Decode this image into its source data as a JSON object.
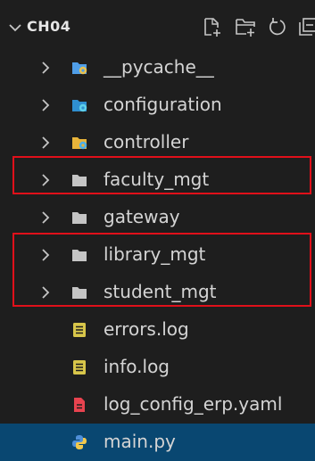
{
  "explorer": {
    "folder_name": "CH04",
    "toolbar": [
      "new-file-icon",
      "new-folder-icon",
      "refresh-icon",
      "collapse-all-icon"
    ],
    "items": [
      {
        "label": "__pycache__",
        "kind": "folder",
        "icon": "pycache-folder-icon",
        "color": "#4f9ee8",
        "accent": "#e8c14f"
      },
      {
        "label": "configuration",
        "kind": "folder",
        "icon": "config-folder-icon",
        "color": "#2f8fd0",
        "accent": "#5fd0e8"
      },
      {
        "label": "controller",
        "kind": "folder",
        "icon": "controller-folder-icon",
        "color": "#e8b43a",
        "accent": "#4fb0e8"
      },
      {
        "label": "faculty_mgt",
        "kind": "folder",
        "icon": "folder-icon",
        "color": "#c5c5c5",
        "highlighted": true
      },
      {
        "label": "gateway",
        "kind": "folder",
        "icon": "folder-icon",
        "color": "#c5c5c5"
      },
      {
        "label": "library_mgt",
        "kind": "folder",
        "icon": "folder-icon",
        "color": "#c5c5c5",
        "highlighted": true
      },
      {
        "label": "student_mgt",
        "kind": "folder",
        "icon": "folder-icon",
        "color": "#c5c5c5",
        "highlighted": true
      },
      {
        "label": "errors.log",
        "kind": "file",
        "icon": "log-file-icon",
        "color": "#d8c64a"
      },
      {
        "label": "info.log",
        "kind": "file",
        "icon": "log-file-icon",
        "color": "#d8c64a"
      },
      {
        "label": "log_config_erp.yaml",
        "kind": "file",
        "icon": "yaml-file-icon",
        "color": "#e8434f"
      },
      {
        "label": "main.py",
        "kind": "file",
        "icon": "python-file-icon",
        "color": "#f2c94c",
        "selected": true
      }
    ]
  },
  "colors": {
    "background": "#1e1e1e",
    "selection": "#094771",
    "highlight_border": "#e0101a"
  }
}
